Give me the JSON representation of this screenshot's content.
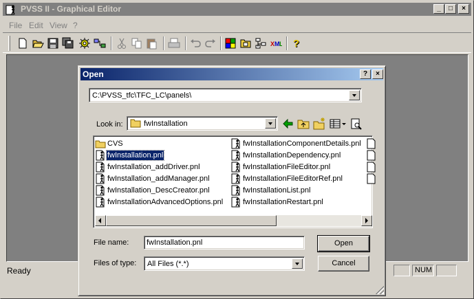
{
  "window": {
    "title": "PVSS II - Graphical Editor",
    "controls": {
      "minimize": "_",
      "maximize": "□",
      "close": "×"
    }
  },
  "menu": {
    "file": "File",
    "edit": "Edit",
    "view": "View",
    "help": "?"
  },
  "toolbar": {
    "icons": [
      "new-icon",
      "open-icon",
      "save-icon",
      "save-all-icon",
      "settings-icon",
      "network-icon",
      "cut-icon",
      "copy-icon",
      "paste-icon",
      "print-icon",
      "undo-icon",
      "redo-icon",
      "color-palette-icon",
      "panel-icon",
      "tree-icon",
      "xml-icon",
      "help-icon"
    ]
  },
  "status": {
    "text": "Ready",
    "num": "NUM"
  },
  "dialog": {
    "title": "Open",
    "help_btn": "?",
    "close_btn": "×",
    "path": "C:\\PVSS_tfc\\TFC_LC\\panels\\",
    "look_in_label": "Look in:",
    "look_in_value": "fwInstallation",
    "files": [
      {
        "name": "CVS",
        "type": "folder",
        "selected": false
      },
      {
        "name": "fwInstallation.pnl",
        "type": "panel",
        "selected": true
      },
      {
        "name": "fwInstallation_addDriver.pnl",
        "type": "panel",
        "selected": false
      },
      {
        "name": "fwInstallation_addManager.pnl",
        "type": "panel",
        "selected": false
      },
      {
        "name": "fwInstallation_DescCreator.pnl",
        "type": "panel",
        "selected": false
      },
      {
        "name": "fwInstallationAdvancedOptions.pnl",
        "type": "panel",
        "selected": false
      },
      {
        "name": "fwInstallationComponentDetails.pnl",
        "type": "panel",
        "selected": false
      },
      {
        "name": "fwInstallationDependency.pnl",
        "type": "panel",
        "selected": false
      },
      {
        "name": "fwInstallationFileEditor.pnl",
        "type": "panel",
        "selected": false
      },
      {
        "name": "fwInstallationFileEditorRef.pnl",
        "type": "panel",
        "selected": false
      },
      {
        "name": "fwInstallationList.pnl",
        "type": "panel",
        "selected": false
      },
      {
        "name": "fwInstallationRestart.pnl",
        "type": "panel",
        "selected": false
      }
    ],
    "file_name_label": "File name:",
    "file_name_value": "fwInstallation.pnl",
    "files_of_type_label": "Files of type:",
    "files_of_type_value": "All Files (*.*)",
    "open_button": "Open",
    "cancel_button": "Cancel"
  },
  "colors": {
    "title_active": "#0a246a",
    "title_gradient_end": "#a6caf0",
    "title_inactive": "#808080",
    "face": "#d4d0c8",
    "workspace": "#808080"
  }
}
